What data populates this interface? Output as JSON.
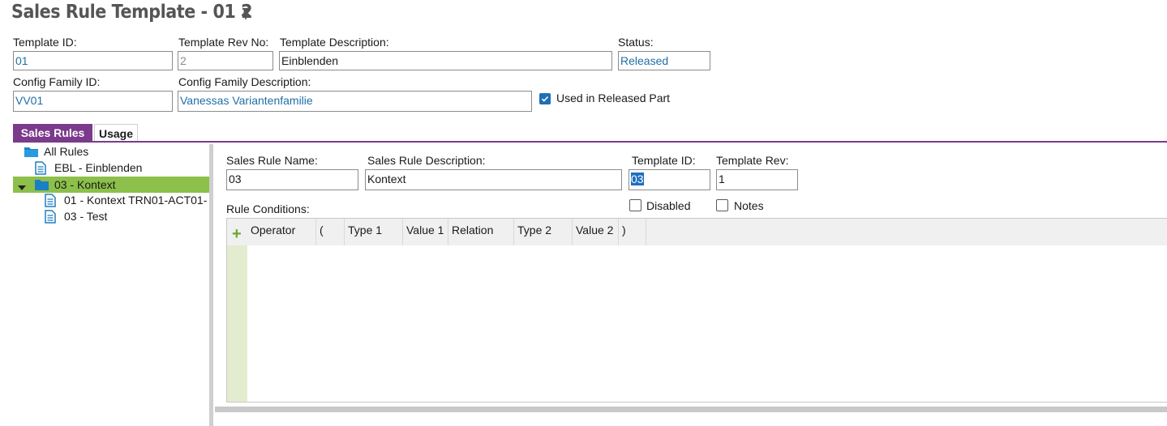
{
  "header": {
    "title": "Sales Rule Template - 01 2",
    "pin_icon": "pin-icon"
  },
  "form": {
    "template_id": {
      "label": "Template ID:",
      "value": "01"
    },
    "template_rev_no": {
      "label": "Template Rev No:",
      "value": "2"
    },
    "template_description": {
      "label": "Template Description:",
      "value": "Einblenden"
    },
    "status": {
      "label": "Status:",
      "value": "Released"
    },
    "config_family_id": {
      "label": "Config Family ID:",
      "value": "VV01"
    },
    "config_family_description": {
      "label": "Config Family Description:",
      "value": "Vanessas Variantenfamilie"
    },
    "used_in_released_part": {
      "label": "Used in Released Part",
      "checked": true
    }
  },
  "tabs": [
    {
      "label": "Sales Rules",
      "active": true
    },
    {
      "label": "Usage",
      "active": false
    }
  ],
  "tree": {
    "root": "All Rules",
    "items": [
      {
        "label": "EBL - Einblenden"
      },
      {
        "label": "03 - Kontext",
        "expanded": true,
        "selected": true,
        "children": [
          {
            "label": "01 - Kontext TRN01-ACT01-"
          },
          {
            "label": "03 - Test"
          }
        ]
      }
    ]
  },
  "detail": {
    "sales_rule_name": {
      "label": "Sales Rule Name:",
      "value": "03"
    },
    "sales_rule_description": {
      "label": "Sales Rule Description:",
      "value": "Kontext"
    },
    "template_id": {
      "label": "Template ID:",
      "value": "03"
    },
    "template_rev": {
      "label": "Template Rev:",
      "value": "1"
    },
    "rule_conditions_label": "Rule Conditions:",
    "disabled": {
      "label": "Disabled",
      "checked": false
    },
    "notes": {
      "label": "Notes",
      "checked": false
    }
  },
  "grid": {
    "add_symbol": "+",
    "columns": [
      "Operator",
      "(",
      "Type 1",
      "Value 1",
      "Relation",
      "Type 2",
      "Value 2",
      ")"
    ]
  },
  "colors": {
    "accent": "#7b3a8c",
    "selection": "#8cc04a",
    "link_blue": "#1f6fa5",
    "checkbox": "#1f6fb5"
  }
}
